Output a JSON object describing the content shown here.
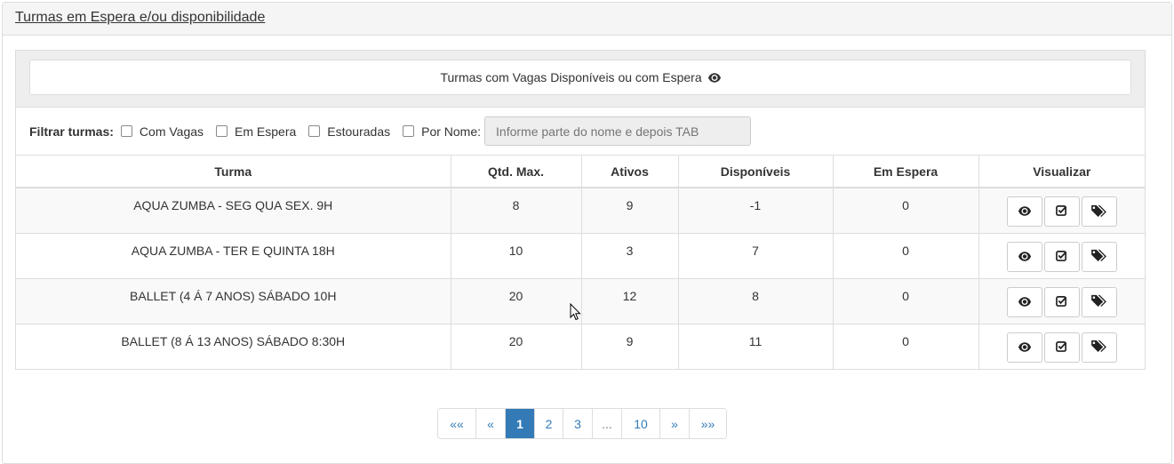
{
  "panel": {
    "title": "Turmas em Espera e/ou disponibilidade"
  },
  "inner": {
    "title": "Turmas com Vagas Disponíveis ou com Espera"
  },
  "filter": {
    "label": "Filtrar turmas:",
    "options": [
      "Com Vagas",
      "Em Espera",
      "Estouradas",
      "Por Nome:"
    ],
    "input_placeholder": "Informe parte do nome e depois TAB"
  },
  "table": {
    "headers": [
      "Turma",
      "Qtd. Max.",
      "Ativos",
      "Disponíveis",
      "Em Espera",
      "Visualizar"
    ],
    "rows": [
      {
        "turma": "AQUA ZUMBA - SEG QUA SEX. 9H",
        "qtd_max": "8",
        "ativos": "9",
        "disponiveis": "-1",
        "em_espera": "0"
      },
      {
        "turma": "AQUA ZUMBA - TER E QUINTA 18H",
        "qtd_max": "10",
        "ativos": "3",
        "disponiveis": "7",
        "em_espera": "0"
      },
      {
        "turma": "BALLET (4 Á 7 ANOS) SÁBADO 10H",
        "qtd_max": "20",
        "ativos": "12",
        "disponiveis": "8",
        "em_espera": "0"
      },
      {
        "turma": "BALLET (8 Á 13 ANOS) SÁBADO 8:30H",
        "qtd_max": "20",
        "ativos": "9",
        "disponiveis": "11",
        "em_espera": "0"
      }
    ]
  },
  "pagination": {
    "items": [
      "««",
      "«",
      "1",
      "2",
      "3",
      "...",
      "10",
      "»",
      "»»"
    ],
    "active": "1"
  },
  "icons": {
    "view": "eye-icon",
    "check": "check-square-icon",
    "tags": "tags-icon"
  },
  "colors": {
    "accent": "#337ab7",
    "border": "#dddddd",
    "heading_bg": "#f5f5f5"
  }
}
